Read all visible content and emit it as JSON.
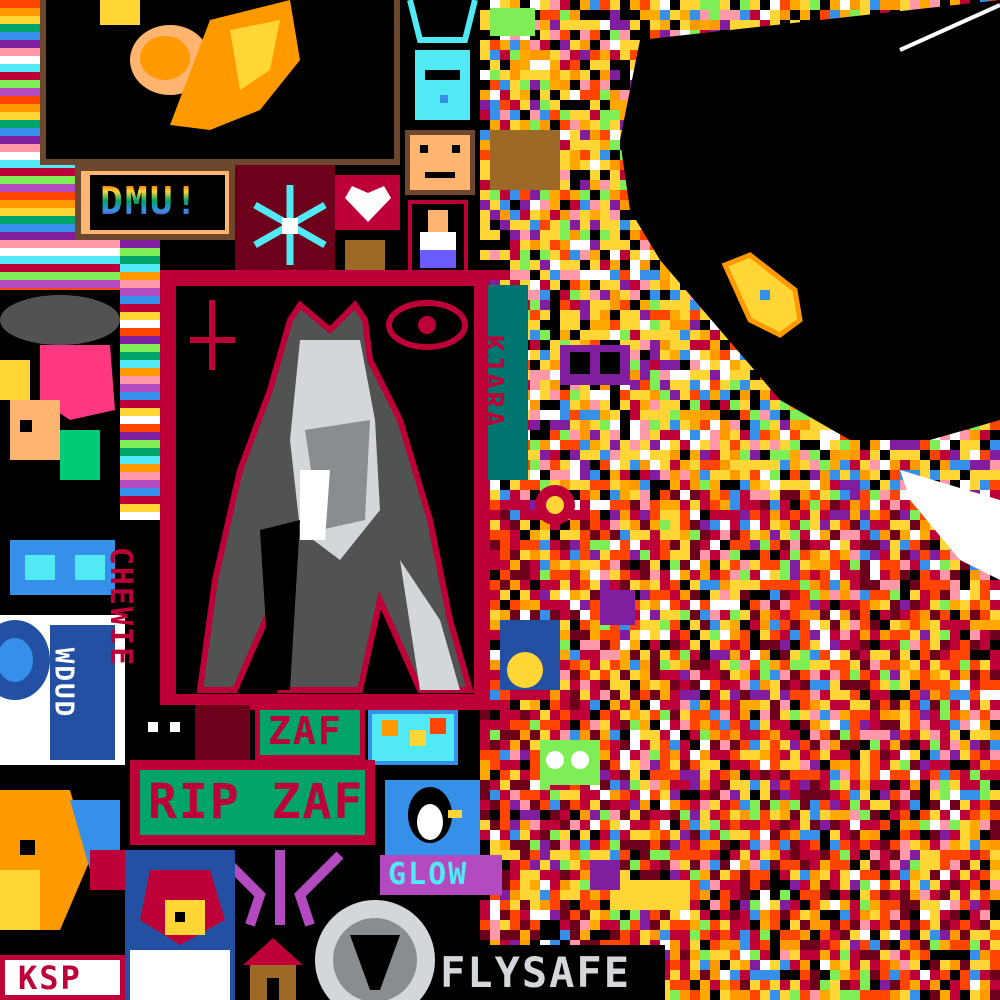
{
  "colors": {
    "crimson": "#be0039",
    "gold": "#ffb470",
    "yellow": "#ffd635",
    "orange": "#ff9900",
    "green": "#00a368",
    "teal": "#00756f",
    "cyan": "#51e9f4",
    "blue": "#3690ea",
    "purple": "#811e9f",
    "grey": "#898d90",
    "lightgrey": "#d4d7d9",
    "white": "#ffffff",
    "black": "#000000",
    "brown": "#6d482f",
    "pink": "#ff99aa"
  },
  "labels": {
    "dmu": "DMU!",
    "zaf": "ZAF",
    "rip_zaf": "RIP ZAF",
    "glow": "GLOW",
    "flysafe": "FLYSAFE",
    "chewie": "CHEWIE",
    "kjara": "KJARA",
    "ksp": "KSP",
    "wdud": "WDUD"
  }
}
